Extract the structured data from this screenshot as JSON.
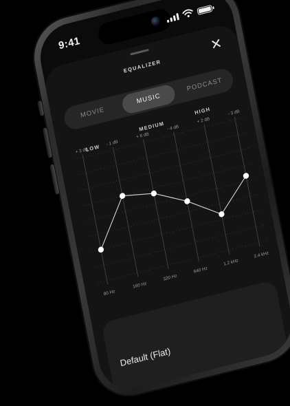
{
  "status_bar": {
    "time": "9:41"
  },
  "equalizer": {
    "title": "EQUALIZER",
    "tabs": [
      {
        "label": "MOVIE",
        "active": false
      },
      {
        "label": "MUSIC",
        "active": true
      },
      {
        "label": "PODCAST",
        "active": false
      }
    ],
    "bands": [
      "LOW",
      "MEDIUM",
      "HIGH"
    ],
    "preset": "Default (Flat)"
  },
  "chart_data": {
    "type": "line",
    "x": [
      "80 Hz",
      "160 Hz",
      "320 Hz",
      "640 Hz",
      "1.2 kHz",
      "2.4 kHz"
    ],
    "top_labels": [
      "+ 3 dB",
      "- 1 dB",
      "+ 6 dB",
      "- 4 dB",
      "+ 2 dB",
      "- 3 dB"
    ],
    "values": [
      -6,
      3,
      2,
      -1,
      -5,
      1
    ],
    "ylim": [
      -12,
      12
    ],
    "grid": true,
    "colors": {
      "line": "#d8d8d8",
      "point": "#ffffff",
      "grid": "#3a3a3a"
    }
  }
}
